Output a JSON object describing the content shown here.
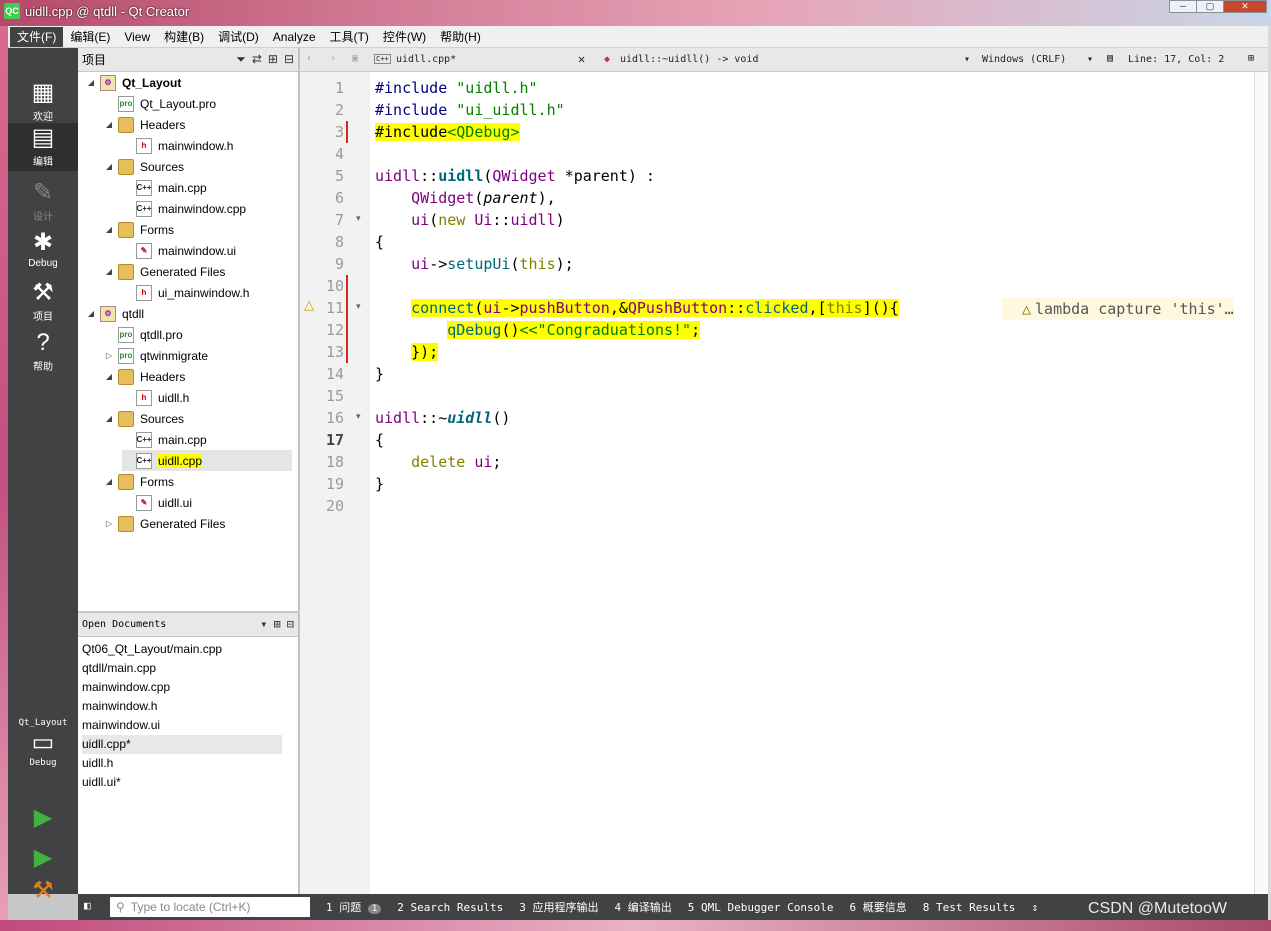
{
  "window": {
    "title": "uidll.cpp @ qtdll - Qt Creator",
    "app_icon": "QC"
  },
  "window_buttons": [
    "─",
    "▢",
    "✕"
  ],
  "menu": [
    "文件(F)",
    "编辑(E)",
    "View",
    "构建(B)",
    "调试(D)",
    "Analyze",
    "工具(T)",
    "控件(W)",
    "帮助(H)"
  ],
  "modes": [
    {
      "label": "欢迎",
      "icon": "grid-icon"
    },
    {
      "label": "编辑",
      "icon": "edit-icon"
    },
    {
      "label": "设计",
      "icon": "pen-icon"
    },
    {
      "label": "Debug",
      "icon": "bug-icon"
    },
    {
      "label": "项目",
      "icon": "wrench-icon"
    },
    {
      "label": "帮助",
      "icon": "help-icon"
    }
  ],
  "kit": {
    "project": "Qt_Layout",
    "config": "Debug"
  },
  "project_pane": {
    "title": "项目"
  },
  "tree": [
    {
      "label": "Qt_Layout",
      "depth": 0,
      "icon": "project",
      "arrow": "◢",
      "bold": true
    },
    {
      "label": "Qt_Layout.pro",
      "depth": 1,
      "icon": "pro",
      "arrow": ""
    },
    {
      "label": "Headers",
      "depth": 1,
      "icon": "folder",
      "arrow": "◢"
    },
    {
      "label": "mainwindow.h",
      "depth": 2,
      "icon": "h",
      "arrow": ""
    },
    {
      "label": "Sources",
      "depth": 1,
      "icon": "folder",
      "arrow": "◢"
    },
    {
      "label": "main.cpp",
      "depth": 2,
      "icon": "cpp",
      "arrow": ""
    },
    {
      "label": "mainwindow.cpp",
      "depth": 2,
      "icon": "cpp",
      "arrow": ""
    },
    {
      "label": "Forms",
      "depth": 1,
      "icon": "folder",
      "arrow": "◢"
    },
    {
      "label": "mainwindow.ui",
      "depth": 2,
      "icon": "ui",
      "arrow": ""
    },
    {
      "label": "Generated Files",
      "depth": 1,
      "icon": "folder",
      "arrow": "◢"
    },
    {
      "label": "ui_mainwindow.h",
      "depth": 2,
      "icon": "h",
      "arrow": ""
    },
    {
      "label": "qtdll",
      "depth": 0,
      "icon": "project",
      "arrow": "◢"
    },
    {
      "label": "qtdll.pro",
      "depth": 1,
      "icon": "pro",
      "arrow": ""
    },
    {
      "label": "qtwinmigrate",
      "depth": 1,
      "icon": "pro",
      "arrow": "▷"
    },
    {
      "label": "Headers",
      "depth": 1,
      "icon": "folder",
      "arrow": "◢"
    },
    {
      "label": "uidll.h",
      "depth": 2,
      "icon": "h",
      "arrow": ""
    },
    {
      "label": "Sources",
      "depth": 1,
      "icon": "folder",
      "arrow": "◢"
    },
    {
      "label": "main.cpp",
      "depth": 2,
      "icon": "cpp",
      "arrow": ""
    },
    {
      "label": "uidll.cpp",
      "depth": 2,
      "icon": "cpp",
      "arrow": "",
      "selected": true
    },
    {
      "label": "Forms",
      "depth": 1,
      "icon": "folder",
      "arrow": "◢"
    },
    {
      "label": "uidll.ui",
      "depth": 2,
      "icon": "ui",
      "arrow": ""
    },
    {
      "label": "Generated Files",
      "depth": 1,
      "icon": "folder",
      "arrow": "▷"
    }
  ],
  "open_docs": {
    "title": "Open Documents",
    "items": [
      "Qt06_Qt_Layout/main.cpp",
      "qtdll/main.cpp",
      "mainwindow.cpp",
      "mainwindow.h",
      "mainwindow.ui",
      "uidll.cpp*",
      "uidll.h",
      "uidll.ui*"
    ]
  },
  "editor": {
    "file_tab": "uidll.cpp*",
    "symbol": "uidll::~uidll() -> void",
    "line_ending": "Windows (CRLF)",
    "position": "Line: 17, Col: 2",
    "current_line": 17
  },
  "code_lines": [
    {
      "n": "1",
      "parts": [
        [
          "pp",
          "#include "
        ],
        [
          "str",
          "\"uidll.h\""
        ]
      ]
    },
    {
      "n": "2",
      "parts": [
        [
          "pp",
          "#include "
        ],
        [
          "str",
          "\"ui_uidll.h\""
        ]
      ]
    },
    {
      "n": "3",
      "parts": [
        [
          "hl",
          "#include"
        ],
        [
          "hl str",
          "<QDebug>"
        ]
      ]
    },
    {
      "n": "4",
      "parts": []
    },
    {
      "n": "5",
      "parts": [
        [
          "ty",
          "uidll"
        ],
        [
          "",
          "::"
        ],
        [
          "bold fn",
          "uidll"
        ],
        [
          "",
          "("
        ],
        [
          "ty",
          "QWidget"
        ],
        [
          "",
          " *"
        ],
        [
          "",
          "parent"
        ],
        [
          "",
          ") :"
        ]
      ]
    },
    {
      "n": "6",
      "parts": [
        [
          "",
          "    "
        ],
        [
          "ty",
          "QWidget"
        ],
        [
          "",
          "("
        ],
        [
          "it",
          "parent"
        ],
        [
          "",
          "),"
        ]
      ]
    },
    {
      "n": "7",
      "parts": [
        [
          "",
          "    "
        ],
        [
          "ty",
          "ui"
        ],
        [
          "",
          "("
        ],
        [
          "kw",
          "new"
        ],
        [
          "",
          " "
        ],
        [
          "ty",
          "Ui"
        ],
        [
          "",
          "::"
        ],
        [
          "ty",
          "uidll"
        ],
        [
          "",
          ")"
        ]
      ]
    },
    {
      "n": "8",
      "parts": [
        [
          "",
          "{"
        ]
      ]
    },
    {
      "n": "9",
      "parts": [
        [
          "",
          "    "
        ],
        [
          "ty",
          "ui"
        ],
        [
          "",
          "->"
        ],
        [
          "fn",
          "setupUi"
        ],
        [
          "",
          "("
        ],
        [
          "kw",
          "this"
        ],
        [
          "",
          ");"
        ]
      ]
    },
    {
      "n": "10",
      "parts": []
    },
    {
      "n": "11",
      "parts": [
        [
          "",
          "    "
        ],
        [
          "hl fn",
          "connect"
        ],
        [
          "hl",
          "("
        ],
        [
          "hl ty",
          "ui"
        ],
        [
          "hl",
          "->"
        ],
        [
          "hl ty",
          "pushButton"
        ],
        [
          "hl",
          ",&"
        ],
        [
          "hl ty",
          "QPushButton"
        ],
        [
          "hl",
          "::"
        ],
        [
          "hl fn",
          "clicked"
        ],
        [
          "hl",
          ",["
        ],
        [
          "hl kw",
          "this"
        ],
        [
          "hl",
          "](){"
        ]
      ]
    },
    {
      "n": "12",
      "parts": [
        [
          "",
          "        "
        ],
        [
          "hl fn",
          "qDebug"
        ],
        [
          "hl",
          "()"
        ],
        [
          "hl str",
          "<<\"Congraduations!\""
        ],
        [
          "hl",
          ";"
        ]
      ]
    },
    {
      "n": "13",
      "parts": [
        [
          "",
          "    "
        ],
        [
          "hl",
          "});"
        ]
      ]
    },
    {
      "n": "14",
      "parts": [
        [
          "",
          "}"
        ]
      ]
    },
    {
      "n": "15",
      "parts": []
    },
    {
      "n": "16",
      "parts": [
        [
          "ty",
          "uidll"
        ],
        [
          "",
          "::~"
        ],
        [
          "bold it fn",
          "uidll"
        ],
        [
          "",
          "()"
        ]
      ]
    },
    {
      "n": "17",
      "parts": [
        [
          "",
          "{"
        ]
      ]
    },
    {
      "n": "18",
      "parts": [
        [
          "",
          "    "
        ],
        [
          "kw",
          "delete"
        ],
        [
          "",
          " "
        ],
        [
          "ty",
          "ui"
        ],
        [
          "",
          ";"
        ]
      ]
    },
    {
      "n": "19",
      "parts": [
        [
          "",
          "}"
        ]
      ]
    },
    {
      "n": "20",
      "parts": []
    }
  ],
  "warning_text": "lambda capture 'this'…",
  "status": {
    "locate_placeholder": "Type to locate (Ctrl+K)",
    "items": [
      "1 问题",
      "2 Search Results",
      "3 应用程序输出",
      "4 编译输出",
      "5 QML Debugger Console",
      "6 概要信息",
      "8 Test Results"
    ],
    "issue_count": "1"
  },
  "watermark": "CSDN @MutetooW"
}
